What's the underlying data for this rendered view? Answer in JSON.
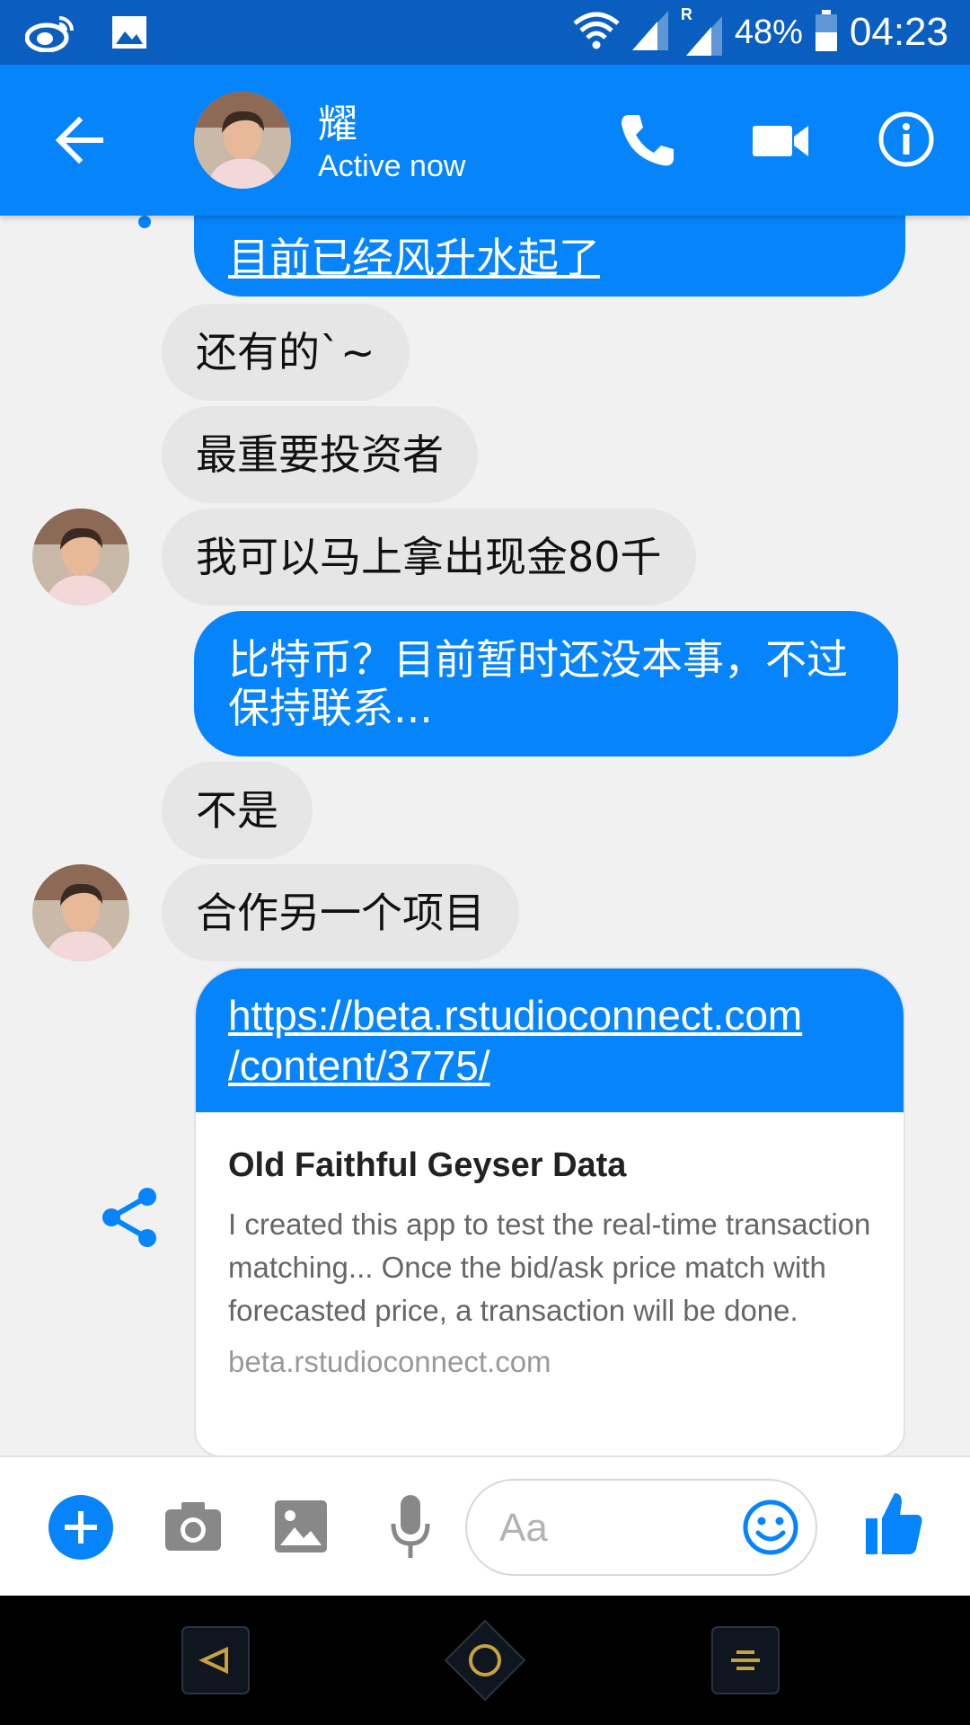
{
  "status_bar": {
    "battery": "48%",
    "time": "04:23",
    "roaming_flag": "R",
    "icons": [
      "weibo-icon",
      "image-icon",
      "wifi-icon",
      "signal-icon",
      "signal-roaming-icon",
      "battery-icon"
    ]
  },
  "header": {
    "contact_name": "耀",
    "status": "Active now",
    "icons": [
      "back-arrow-icon",
      "phone-icon",
      "video-camera-icon",
      "info-icon"
    ]
  },
  "messages": [
    {
      "side": "out",
      "text": "目前已经风升水起了",
      "underline": true
    },
    {
      "side": "in",
      "text": "还有的`~"
    },
    {
      "side": "in",
      "text": "最重要投资者"
    },
    {
      "side": "in",
      "text": "我可以马上拿出现金80千"
    },
    {
      "side": "out",
      "text": "比特币？目前暂时还没本事，不过保持联系..."
    },
    {
      "side": "in",
      "text": "不是"
    },
    {
      "side": "in",
      "text": "合作另一个项目"
    }
  ],
  "link_message": {
    "url_line1": "https://beta.rstudioconnect.com",
    "url_line2": "/content/3775/",
    "preview_title": "Old Faithful Geyser Data",
    "preview_description": "I created this app to test the real-time transaction matching... Once the bid/ask price match with forecasted price, a transaction will be done.",
    "preview_domain": "beta.rstudioconnect.com"
  },
  "composer": {
    "placeholder": "Aa",
    "icons": [
      "plus-icon",
      "camera-icon",
      "gallery-icon",
      "microphone-icon",
      "emoji-icon",
      "thumbs-up-icon"
    ]
  },
  "nav_bar": {
    "icons": [
      "nav-back-icon",
      "nav-home-icon",
      "nav-menu-icon"
    ]
  },
  "colors": {
    "accent": "#0684fc",
    "status_bar": "#0a5ec0",
    "incoming_bubble": "#e6e6e6",
    "chat_background": "#f1f1f1",
    "nav_button_gold": "#c8a23c"
  }
}
